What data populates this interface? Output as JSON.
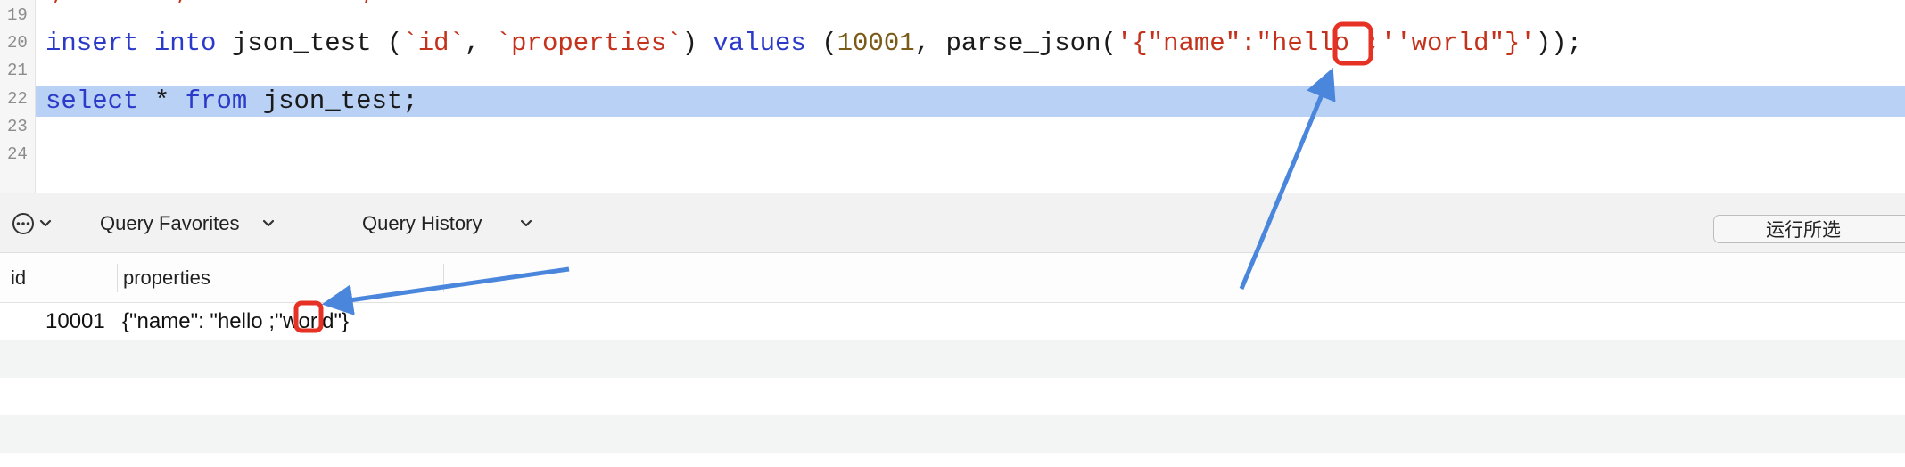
{
  "editor": {
    "partial_line": "',       ,           ,",
    "line_numbers": [
      "19",
      "20",
      "21",
      "22",
      "23",
      "24"
    ],
    "insert_line": {
      "kw1": "insert",
      "kw2": "into",
      "table": "json_test (",
      "col1": "`id`",
      "comma1": ", ",
      "col2": "`properties`",
      "paren": ") ",
      "kw3": "values",
      "open": " (",
      "number": "10001",
      "func": ", parse_json(",
      "string_a": "'{\"name\":\"hello ;",
      "string_b": "''",
      "string_c": "world\"}'",
      "close": "));"
    },
    "select_line": {
      "kw1": "select",
      "star": " * ",
      "kw2": "from",
      "rest": " json_test;"
    }
  },
  "toolbar": {
    "more_icon": "ellipsis-circle-icon",
    "favorites_label": "Query Favorites",
    "history_label": "Query History",
    "run_selected_label": "运行所选"
  },
  "results": {
    "columns": [
      "id",
      "properties"
    ],
    "rows": [
      {
        "id": "10001",
        "properties": "{\"name\": \"hello ;''world\"}"
      }
    ]
  },
  "colors": {
    "keyword": "#2b3ac8",
    "string": "#c4321c",
    "number": "#7a5a17",
    "selection": "#b8d1f5",
    "annotation_box": "#e53224",
    "annotation_arrow": "#4a86dc"
  }
}
